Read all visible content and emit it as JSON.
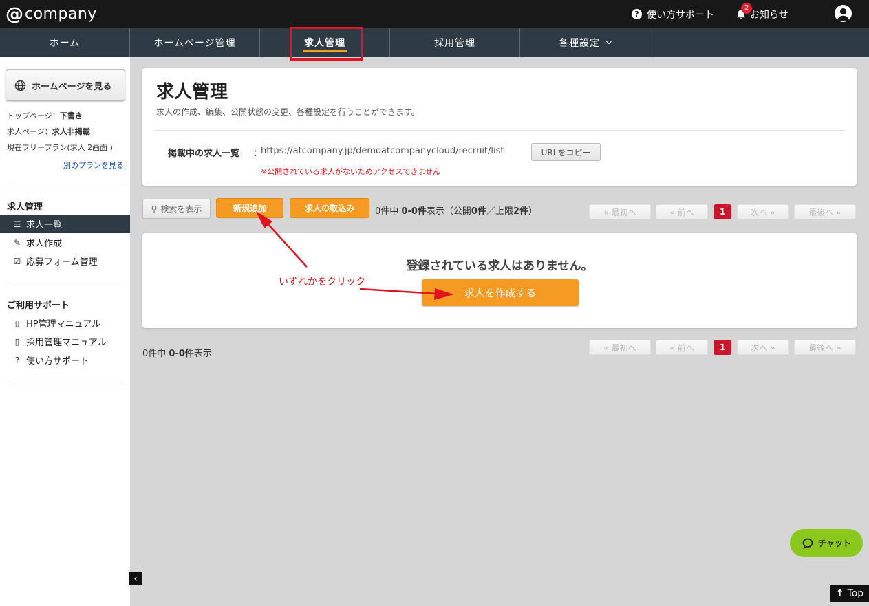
{
  "header": {
    "logo_at": "@",
    "logo_text": "company",
    "support_label": "使い方サポート",
    "notice_label": "お知らせ",
    "notice_count": "2"
  },
  "nav": {
    "tabs": [
      {
        "label": "ホーム"
      },
      {
        "label": "ホームページ管理"
      },
      {
        "label": "求人管理",
        "active": true
      },
      {
        "label": "採用管理"
      },
      {
        "label": "各種設定"
      }
    ]
  },
  "sidebar": {
    "view_home_label": "ホームページを見る",
    "top_page_label": "トップページ：",
    "top_page_status": "下書き",
    "job_page_label": "求人ページ：",
    "job_page_status": "求人非掲載",
    "plan_label": "現在フリープラン(求人 2画面 )",
    "plan_link": "別のプランを見る",
    "job_section_title": "求人管理",
    "job_items": [
      {
        "label": "求人一覧",
        "active": true
      },
      {
        "label": "求人作成"
      },
      {
        "label": "応募フォーム管理"
      }
    ],
    "support_section_title": "ご利用サポート",
    "support_items": [
      {
        "label": "HP管理マニュアル"
      },
      {
        "label": "採用管理マニュアル"
      },
      {
        "label": "使い方サポート"
      }
    ]
  },
  "main": {
    "title": "求人管理",
    "description": "求人の作成、編集、公開状態の変更、各種設定を行うことができます。",
    "url_label": "掲載中の求人一覧",
    "url_colon": "：",
    "url_value": "https://atcompany.jp/demoatcompanycloud/recruit/list",
    "copy_button": "URLをコピー",
    "url_note": "※公開されている求人がないためアクセスできません",
    "search_button": "検索を表示",
    "new_button": "新規追加",
    "import_button": "求人の取込み",
    "count_prefix": "0件中 ",
    "count_range": "0-0件",
    "count_suffix": "表示（公開",
    "count_public": "0件",
    "count_limit_prefix": "／上限",
    "count_limit": "2件",
    "count_close": "）",
    "pagination": {
      "first": "« 最初へ",
      "prev": "« 前へ",
      "current": "1",
      "next": "次へ »",
      "last": "最後へ »"
    },
    "empty_message": "登録されている求人はありません。",
    "create_button": "求人を作成する",
    "bottom_count_prefix": "0件中 ",
    "bottom_count_range": "0-0件",
    "bottom_count_suffix": "表示"
  },
  "annotation": {
    "text": "いずれかをクリック",
    "color": "#e0141e"
  },
  "widgets": {
    "chat_label": "チャット",
    "top_label": "Top"
  },
  "colors": {
    "accent_orange": "#f59a23",
    "nav_dark": "#2e3a44",
    "page_current": "#c8162c",
    "chat_green": "#8bc81e"
  }
}
